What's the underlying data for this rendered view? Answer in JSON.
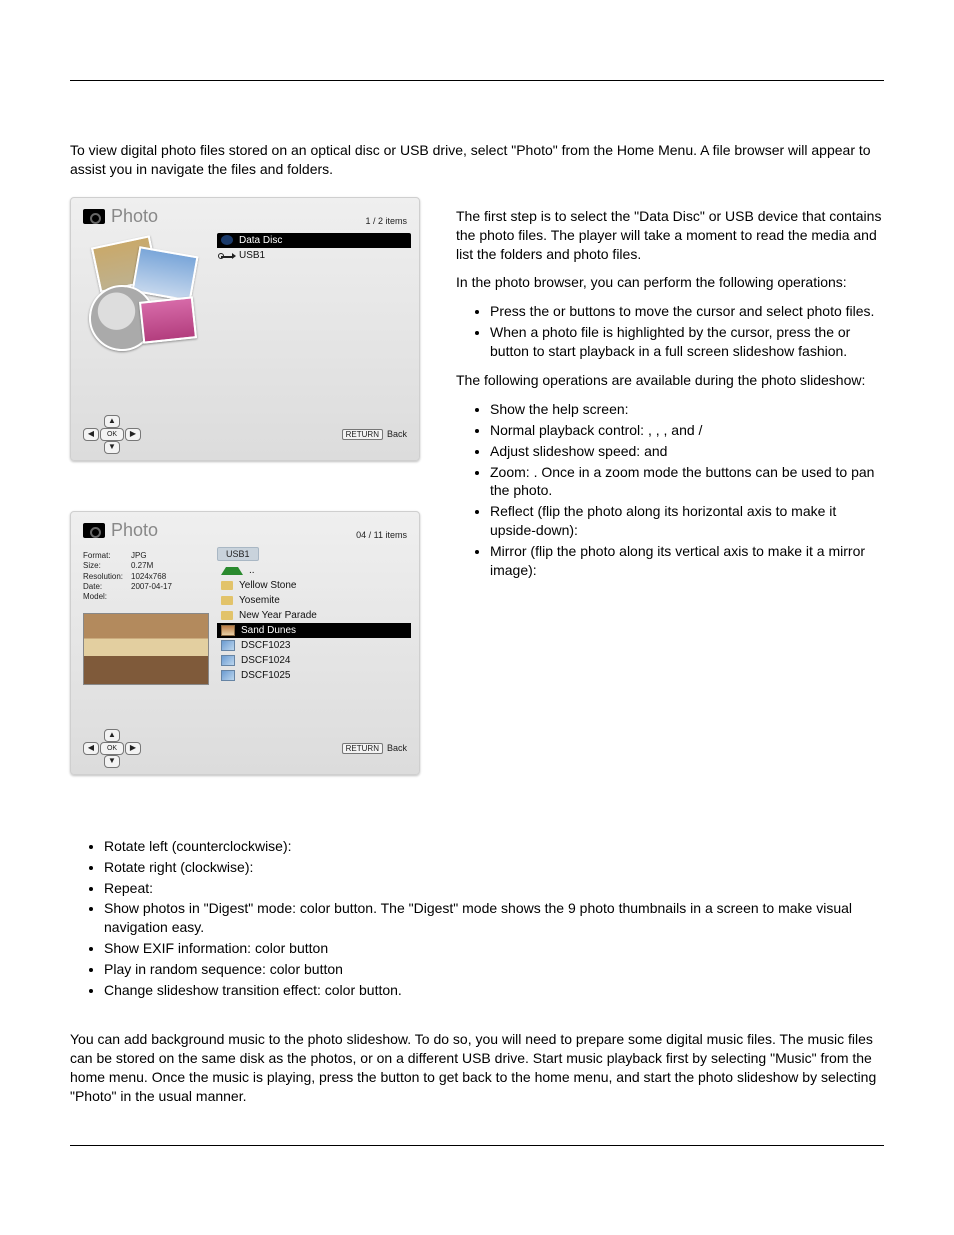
{
  "intro": "To view digital photo files stored on an optical disc or USB drive, select \"Photo\" from the Home Menu.  A file browser will appear to assist you in navigate the files and folders.",
  "shot1": {
    "title": "Photo",
    "count": "1 / 2 items",
    "items": [
      {
        "icon": "disc",
        "label": "Data Disc",
        "selected": true
      },
      {
        "icon": "usb",
        "label": "USB1",
        "selected": false
      }
    ],
    "returnLabel": "Back",
    "returnBtn": "RETURN",
    "ok": "OK"
  },
  "shot2": {
    "title": "Photo",
    "count": "04 / 11 items",
    "location": "USB1",
    "meta": {
      "Format": "JPG",
      "Size": "0.27M",
      "Resolution": "1024x768",
      "Date": "2007-04-17",
      "Model": ""
    },
    "items": [
      {
        "icon": "up",
        "label": "..",
        "selected": false
      },
      {
        "icon": "fold",
        "label": "Yellow Stone",
        "selected": false
      },
      {
        "icon": "fold",
        "label": "Yosemite",
        "selected": false
      },
      {
        "icon": "fold",
        "label": "New Year Parade",
        "selected": false
      },
      {
        "icon": "img2",
        "label": "Sand Dunes",
        "selected": true
      },
      {
        "icon": "img",
        "label": "DSCF1023",
        "selected": false
      },
      {
        "icon": "img",
        "label": "DSCF1024",
        "selected": false
      },
      {
        "icon": "img",
        "label": "DSCF1025",
        "selected": false
      }
    ],
    "returnLabel": "Back",
    "returnBtn": "RETURN",
    "ok": "OK"
  },
  "right": {
    "p1": "The first step is to select the \"Data Disc\" or USB device that contains the photo files.  The player will take a moment to read the media and list the folders and photo files.",
    "p2": "In the photo browser, you can perform the following operations:",
    "browserOps": [
      "Press the                                     or                          buttons to move the cursor and select photo files.",
      "When a photo file is highlighted by the cursor, press the                  or               button to start playback in a full screen slideshow fashion."
    ],
    "p3": "The following operations are available during the photo slideshow:",
    "slideOps": [
      "Show the help screen:",
      "Normal playback control:              ,          ,             , and             /",
      "Adjust slideshow speed:             and",
      "Zoom:            .  Once in a zoom mode the                   buttons can be used to pan the photo.",
      "Reflect (flip the photo along its horizontal axis to make it upside-down):",
      "Mirror (flip the photo along its vertical axis to make it a mirror image):"
    ]
  },
  "belowOps": [
    "Rotate left (counterclockwise):",
    "Rotate right (clockwise):",
    "Repeat:",
    "Show photos in \"Digest\" mode:            color button. The \"Digest\" mode shows the 9 photo thumbnails in a screen to make visual navigation easy.",
    "Show EXIF information:                 color button",
    "Play in random sequence:               color button",
    "Change slideshow transition effect:                 color button."
  ],
  "bgmusic": "You can add background music to the photo slideshow.  To do so, you will need to prepare some digital music files.  The music files can be stored on the same disk as the photos, or on a different USB drive.  Start music playback first by selecting \"Music\" from the home menu.  Once the music is playing, press the             button to get back to the home menu, and start the photo slideshow by selecting \"Photo\" in the usual manner."
}
